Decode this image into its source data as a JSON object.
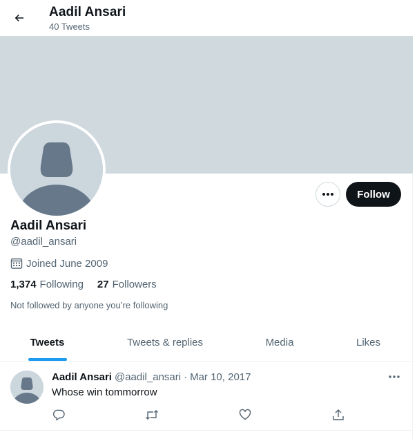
{
  "header": {
    "title": "Aadil Ansari",
    "tweet_count": "40 Tweets"
  },
  "profile": {
    "display_name": "Aadil Ansari",
    "handle": "@aadil_ansari",
    "joined": "Joined June 2009",
    "following_count": "1,374",
    "following_label": "Following",
    "followers_count": "27",
    "followers_label": "Followers",
    "not_followed_text": "Not followed by anyone you’re following"
  },
  "actions": {
    "follow_label": "Follow",
    "more_icon": "more-horizontal-icon"
  },
  "tabs": [
    {
      "label": "Tweets",
      "active": true
    },
    {
      "label": "Tweets & replies",
      "active": false
    },
    {
      "label": "Media",
      "active": false
    },
    {
      "label": "Likes",
      "active": false
    }
  ],
  "tweet": {
    "name": "Aadil Ansari",
    "handle": "@aadil_ansari",
    "separator": "·",
    "date": "Mar 10, 2017",
    "text": "Whose win tommorrow",
    "actions": [
      "reply-icon",
      "retweet-icon",
      "like-icon",
      "share-icon"
    ]
  },
  "colors": {
    "banner": "#cfd9de",
    "avatar_placeholder": "#ccd6dd",
    "silhouette": "#66788a",
    "accent": "#1d9bf0",
    "primary_text": "#0f1419",
    "secondary_text": "#536471"
  }
}
